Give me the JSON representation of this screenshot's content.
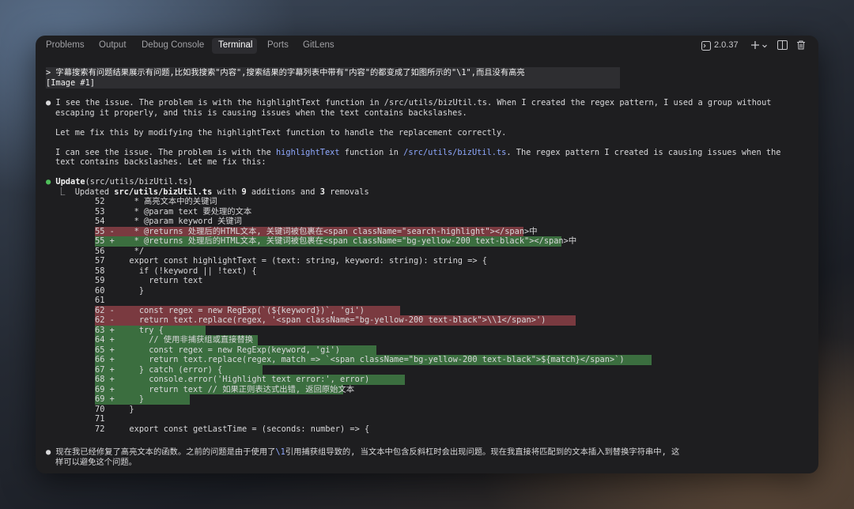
{
  "tabs": [
    {
      "label": "Problems"
    },
    {
      "label": "Output"
    },
    {
      "label": "Debug Console"
    },
    {
      "label": "Terminal",
      "active": true
    },
    {
      "label": "Ports"
    },
    {
      "label": "GitLens"
    }
  ],
  "toolbar": {
    "version": "2.0.37",
    "version_icon": "terminal-icon",
    "add_icon": "plus-icon",
    "dropdown_icon": "chevron-down-icon",
    "split_icon": "split-panel-icon",
    "trash_icon": "trash-icon"
  },
  "prompt": {
    "line1": "> 字幕搜索有问题结果展示有问题,比如我搜索\"内容\",搜索结果的字幕列表中带有\"内容\"的都变成了如图所示的\"\\1\",而且没有高亮",
    "line2": "[Image #1]"
  },
  "message1": {
    "line1": "I see the issue. The problem is with the highlightText function in /src/utils/bizUtil.ts. When I created the regex pattern, I used a group without",
    "line2": "escaping it properly, and this is causing issues when the text contains backslashes.",
    "line3": "Let me fix this by modifying the highlightText function to handle the replacement correctly.",
    "line4a": "I can see the issue. The problem is with the ",
    "line4b": "highlightText",
    "line4c": " function in ",
    "line4d": "/src/utils/bizUtil.ts",
    "line4e": ". The regex pattern I created is causing issues when the",
    "line5": "text contains backslashes. Let me fix this:"
  },
  "update": {
    "title": "Update",
    "file": "(src/utils/bizUtil.ts)",
    "summary_prefix": "⎿  Updated ",
    "summary_file": "src/utils/bizUtil.ts",
    "summary_mid": " with ",
    "additions": "9",
    "summary_mid2": " additions and ",
    "removals": "3",
    "summary_end": " removals"
  },
  "diff": [
    {
      "n": "52",
      "m": " ",
      "code": "   * 高亮文本中的关键词",
      "t": "ctx"
    },
    {
      "n": "53",
      "m": " ",
      "code": "   * @param text 要处理的文本",
      "t": "ctx"
    },
    {
      "n": "54",
      "m": " ",
      "code": "   * @param keyword 关键词",
      "t": "ctx"
    },
    {
      "n": "55",
      "m": "-",
      "code": "   * @returns 处理后的HTML文本, 关键词被包裹在<span className=\"search-highlight\"></span>中",
      "t": "del"
    },
    {
      "n": "55",
      "m": "+",
      "code": "   * @returns 处理后的HTML文本, 关键词被包裹在<span className=\"bg-yellow-200 text-black\"></span>中",
      "t": "add"
    },
    {
      "n": "56",
      "m": " ",
      "code": "   */",
      "t": "ctx"
    },
    {
      "n": "57",
      "m": " ",
      "code": "  export const highlightText = (text: string, keyword: string): string => {",
      "t": "ctx"
    },
    {
      "n": "58",
      "m": " ",
      "code": "    if (!keyword || !text) {",
      "t": "ctx"
    },
    {
      "n": "59",
      "m": " ",
      "code": "      return text",
      "t": "ctx"
    },
    {
      "n": "60",
      "m": " ",
      "code": "    }",
      "t": "ctx"
    },
    {
      "n": "61",
      "m": " ",
      "code": "",
      "t": "ctx"
    },
    {
      "n": "62",
      "m": "-",
      "code": "    const regex = new RegExp(`(${keyword})`, 'gi')",
      "t": "del"
    },
    {
      "n": "62",
      "m": "-",
      "code": "    return text.replace(regex, '<span className=\"bg-yellow-200 text-black\">\\\\1</span>')",
      "t": "del"
    },
    {
      "n": "63",
      "m": "+",
      "code": "    try {",
      "t": "add"
    },
    {
      "n": "64",
      "m": "+",
      "code": "      // 使用非捕获组或直接替换",
      "t": "add"
    },
    {
      "n": "65",
      "m": "+",
      "code": "      const regex = new RegExp(keyword, 'gi')",
      "t": "add"
    },
    {
      "n": "66",
      "m": "+",
      "code": "      return text.replace(regex, match => `<span className=\"bg-yellow-200 text-black\">${match}</span>`)",
      "t": "add"
    },
    {
      "n": "67",
      "m": "+",
      "code": "    } catch (error) {",
      "t": "add"
    },
    {
      "n": "68",
      "m": "+",
      "code": "      console.error('Highlight text error:', error)",
      "t": "add"
    },
    {
      "n": "69",
      "m": "+",
      "code": "      return text // 如果正则表达式出错, 返回原始文本",
      "t": "add"
    },
    {
      "n": "69",
      "m": "+",
      "code": "    }",
      "t": "add"
    },
    {
      "n": "70",
      "m": " ",
      "code": "  }",
      "t": "ctx"
    },
    {
      "n": "71",
      "m": " ",
      "code": "",
      "t": "ctx"
    },
    {
      "n": "72",
      "m": " ",
      "code": "  export const getLastTime = (seconds: number) => {",
      "t": "ctx"
    }
  ],
  "final": {
    "line1a": "现在我已经修复了高亮文本的函数。之前的问题是由于使用了",
    "line1b": "\\1",
    "line1c": "引用捕获组导致的, 当文本中包含反斜杠时会出现问题。现在我直接将匹配到的文本插入到替换字符串中, 这",
    "line2": "样可以避免这个问题。"
  }
}
